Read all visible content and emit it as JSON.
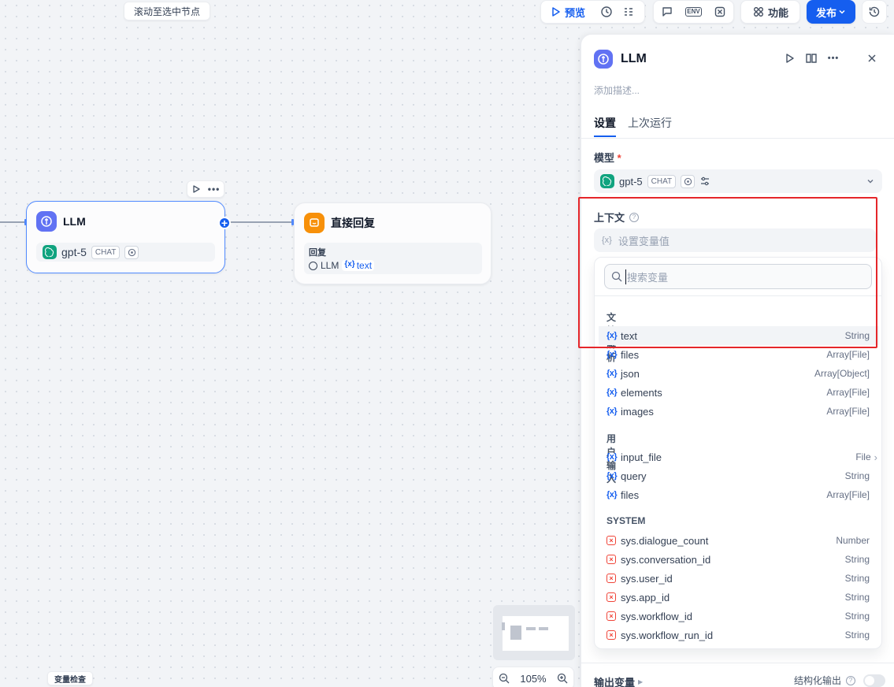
{
  "canvas": {
    "scroll_to_selected": "滚动至选中节点",
    "variable_inspect": "变量检查",
    "zoom_level": "105%"
  },
  "topbar": {
    "preview": "预览",
    "features": "功能",
    "publish": "发布"
  },
  "nodes": {
    "llm": {
      "title": "LLM",
      "model": "gpt-5",
      "mode_tag": "CHAT"
    },
    "answer": {
      "title": "直接回复",
      "reply_label": "回复",
      "ref_node": "LLM",
      "ref_var": "text"
    }
  },
  "panel": {
    "title": "LLM",
    "description_placeholder": "添加描述...",
    "tabs": [
      "设置",
      "上次运行"
    ],
    "model_label": "模型",
    "required_mark": "*",
    "model_name": "gpt-5",
    "model_tag": "CHAT",
    "context_label": "上下文",
    "set_var_placeholder": "设置变量值",
    "search_placeholder": "搜索变量",
    "groups": [
      {
        "title": "文档解析",
        "vars": [
          {
            "name": "text",
            "type": "String"
          },
          {
            "name": "files",
            "type": "Array[File]"
          },
          {
            "name": "json",
            "type": "Array[Object]"
          },
          {
            "name": "elements",
            "type": "Array[File]"
          },
          {
            "name": "images",
            "type": "Array[File]"
          }
        ]
      },
      {
        "title": "用户输入",
        "vars": [
          {
            "name": "input_file",
            "type": "File"
          },
          {
            "name": "query",
            "type": "String"
          },
          {
            "name": "files",
            "type": "Array[File]"
          }
        ]
      },
      {
        "title": "SYSTEM",
        "vars": [
          {
            "name": "sys.dialogue_count",
            "type": "Number"
          },
          {
            "name": "sys.conversation_id",
            "type": "String"
          },
          {
            "name": "sys.user_id",
            "type": "String"
          },
          {
            "name": "sys.app_id",
            "type": "String"
          },
          {
            "name": "sys.workflow_id",
            "type": "String"
          },
          {
            "name": "sys.workflow_run_id",
            "type": "String"
          }
        ]
      }
    ],
    "output_vars": "输出变量",
    "structured_output": "结构化输出"
  },
  "colors": {
    "accent": "#155eef",
    "llm_icon": "#6172f3",
    "answer_icon": "#f79009",
    "highlight_box": "#e5262a"
  }
}
